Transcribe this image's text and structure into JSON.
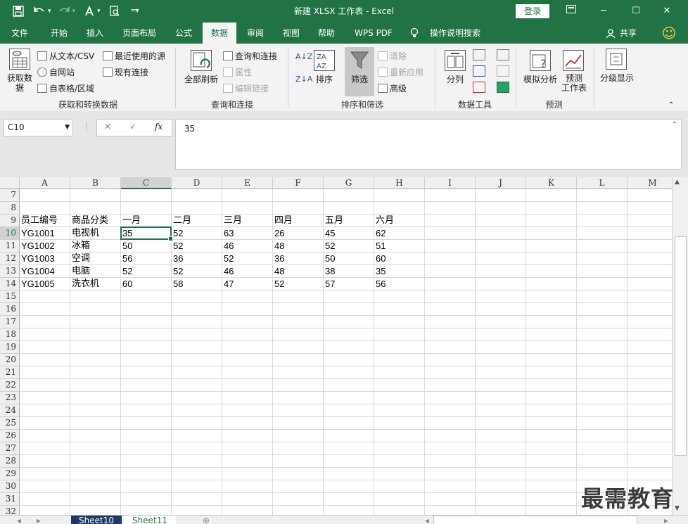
{
  "titlebar": {
    "title": "新建 XLSX 工作表  -  Excel",
    "login": "登录",
    "qat_save_icon": "save-icon",
    "qat_undo_icon": "undo-icon",
    "qat_redo_icon": "redo-icon",
    "qat_format_icon": "format-painter-icon",
    "qat_preview_icon": "print-preview-icon",
    "qat_customize_icon": "customize-icon",
    "ribbon_display_icon": "ribbon-display-icon",
    "minimize": "─",
    "maximize": "☐",
    "close": "✕"
  },
  "tabs": [
    {
      "label": "文件"
    },
    {
      "label": "开始"
    },
    {
      "label": "插入"
    },
    {
      "label": "页面布局"
    },
    {
      "label": "公式"
    },
    {
      "label": "数据"
    },
    {
      "label": "审阅"
    },
    {
      "label": "视图"
    },
    {
      "label": "帮助"
    },
    {
      "label": "WPS PDF"
    },
    {
      "label": "操作说明搜索"
    }
  ],
  "tabs_extra": {
    "share": "共享",
    "smiley": "☺"
  },
  "ribbon": {
    "get_data": {
      "get_data_btn": "获取数\n据",
      "from_text": "从文本/CSV",
      "from_web": "自网站",
      "from_table": "自表格/区域",
      "recent_sources": "最近使用的源",
      "existing_conn": "现有连接",
      "label": "获取和转换数据"
    },
    "query": {
      "refresh_all": "全部刷新",
      "queries_conn": "查询和连接",
      "properties": "属性",
      "edit_links": "编辑链接",
      "label": "查询和连接"
    },
    "sort": {
      "sort_btn": "排序",
      "filter_btn": "筛选",
      "clear": "清除",
      "reapply": "重新应用",
      "advanced": "高级",
      "label": "排序和筛选"
    },
    "tools": {
      "split": "分列",
      "label": "数据工具"
    },
    "forecast": {
      "whatif": "模拟分析",
      "sheet": "预测\n工作表",
      "label": "预测"
    },
    "outline": {
      "label": "分级显示"
    }
  },
  "formula_bar": {
    "name_box": "C10",
    "cancel": "✕",
    "enter": "✓",
    "fx": "fx",
    "content": "35"
  },
  "columns": [
    "A",
    "B",
    "C",
    "D",
    "E",
    "F",
    "G",
    "H",
    "I",
    "J",
    "K",
    "L",
    "M"
  ],
  "rows": [
    7,
    8,
    9,
    10,
    11,
    12,
    13,
    14,
    15,
    16,
    17,
    18,
    19,
    20,
    21,
    22,
    23,
    24,
    25,
    26,
    27,
    28,
    29,
    30,
    31,
    32
  ],
  "table": {
    "header_row": 9,
    "headers": [
      "员工编号",
      "商品分类",
      "一月",
      "二月",
      "三月",
      "四月",
      "五月",
      "六月"
    ],
    "data": [
      [
        "YG1001",
        "电视机",
        "35",
        "52",
        "63",
        "26",
        "45",
        "62"
      ],
      [
        "YG1002",
        "冰箱",
        "50",
        "52",
        "46",
        "48",
        "52",
        "51"
      ],
      [
        "YG1003",
        "空调",
        "56",
        "36",
        "52",
        "36",
        "50",
        "60"
      ],
      [
        "YG1004",
        "电脑",
        "52",
        "52",
        "46",
        "48",
        "38",
        "35"
      ],
      [
        "YG1005",
        "洗衣机",
        "60",
        "58",
        "47",
        "52",
        "57",
        "56"
      ]
    ]
  },
  "active_cell": "C10",
  "sheets": [
    {
      "name": "Sheet10",
      "active": false
    },
    {
      "name": "Sheet11",
      "active": true
    }
  ],
  "watermark": "最需教育",
  "colors": {
    "accent": "#217346",
    "ribbon_bg": "#f3f3f3"
  }
}
